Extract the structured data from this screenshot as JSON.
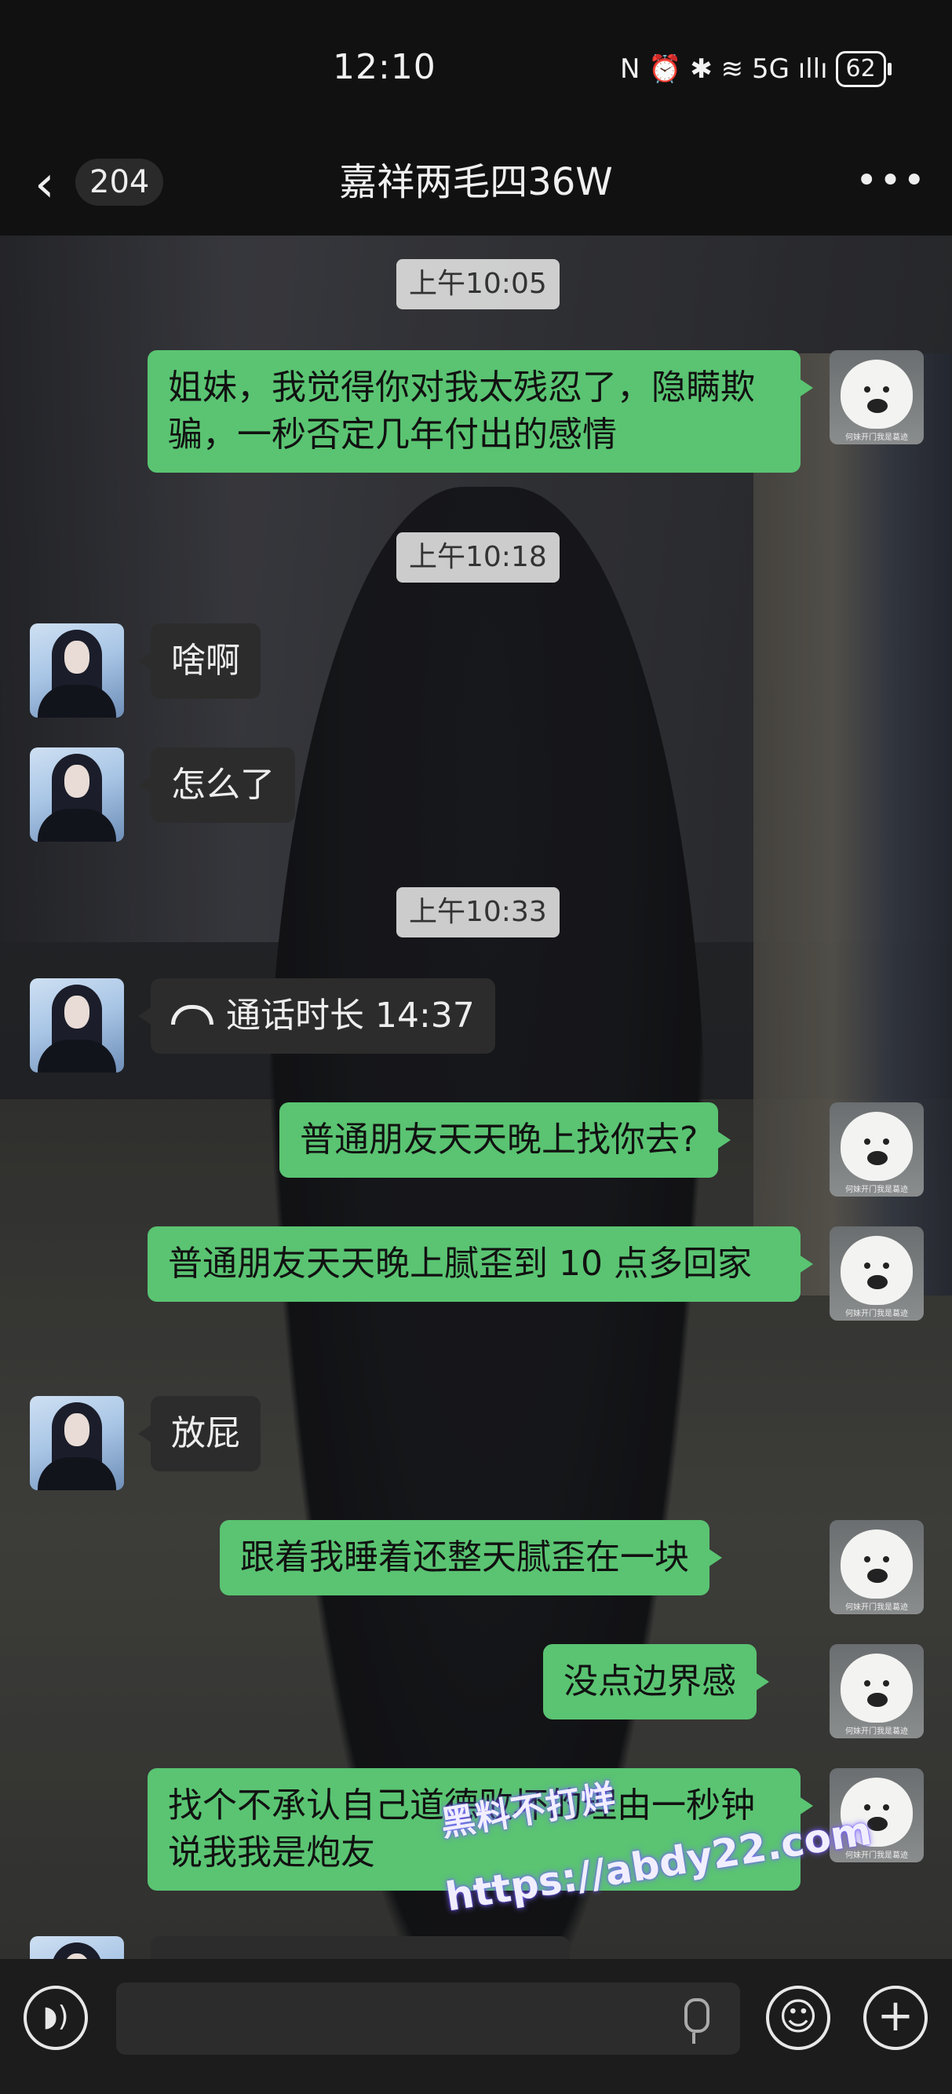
{
  "status_bar": {
    "time": "12:10",
    "icons": "N ⏰ ✱ ≋ 5G ıllı",
    "battery": "62"
  },
  "nav": {
    "back_icon": "chevron-left-icon",
    "unread_count": "204",
    "title": "嘉祥两毛四36W",
    "more_icon": "more-dots-icon",
    "more_label": "•••"
  },
  "messages": {
    "ts1": "上午10:05",
    "m1": "姐妹，我觉得你对我太残忍了，隐瞒欺骗，一秒否定几年付出的感情",
    "ts2": "上午10:18",
    "m2": "啥啊",
    "m3": "怎么了",
    "ts3": "上午10:33",
    "m4": "通话时长 14:37",
    "m5": "普通朋友天天晚上找你去?",
    "m6": "普通朋友天天晚上腻歪到 10 点多回家",
    "m7": "放屁",
    "m8": "跟着我睡着还整天腻歪在一块",
    "m9": "没点边界感",
    "m10": "找个不承认自己道德败坏的理由一秒钟说我我是炮友"
  },
  "avatar_caption": "何妹开门我是葛迹",
  "watermark": {
    "line1": "黑料不打烊",
    "line2": "https://abdy22.com"
  },
  "input_bar": {
    "voice_icon": "voice-icon",
    "mic_icon": "microphone-icon",
    "emoji_icon": "emoji-icon",
    "plus_icon": "plus-icon"
  },
  "colors": {
    "my_bubble": "#5ac472",
    "their_bubble": "#2c2c2c",
    "timestamp_bg": "#dcdcdc"
  }
}
